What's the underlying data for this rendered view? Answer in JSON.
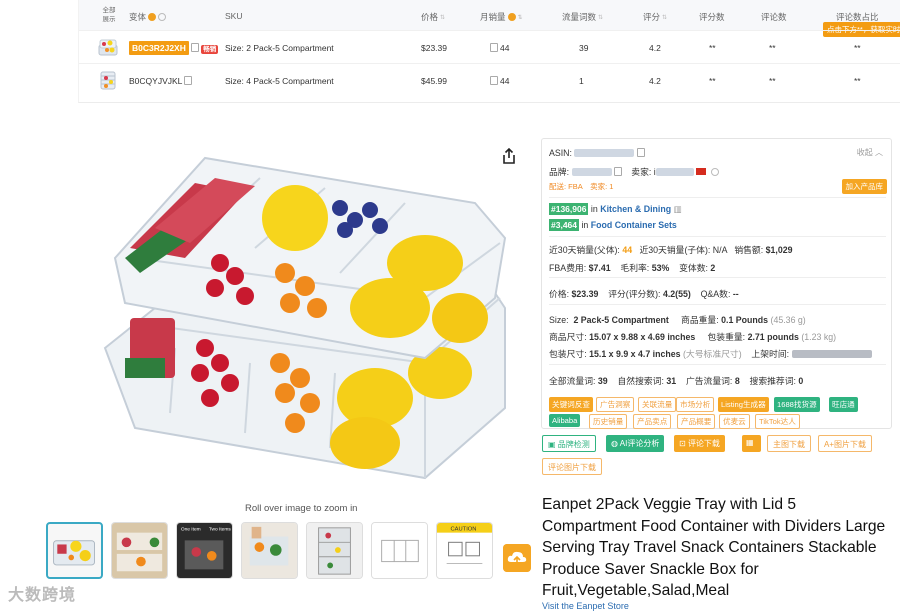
{
  "variant_table": {
    "select_all": "全部展示",
    "columns": {
      "variant": "变体",
      "sku": "SKU",
      "price": "价格",
      "monthly_sales": "月销量",
      "traffic_words": "流量词数",
      "rating": "评分",
      "rating_score": "评分数",
      "review_count": "评论数",
      "review_ratio": "评论数占比"
    },
    "tooltip": "点击下方**，获取实时数据",
    "rows": [
      {
        "asin": "B0C3R2J2XH",
        "tag": "畅销",
        "sku": "Size: 2 Pack-5 Compartment",
        "price": "$23.39",
        "sales": "44",
        "traffic": "39",
        "rating": "4.2",
        "rating_score": "**",
        "reviews": "**",
        "ratio": "**"
      },
      {
        "asin": "B0CQYJVJKL",
        "tag": "",
        "sku": "Size: 4 Pack-5 Compartment",
        "price": "$45.99",
        "sales": "44",
        "traffic": "1",
        "rating": "4.2",
        "rating_score": "**",
        "reviews": "**",
        "ratio": "**"
      }
    ]
  },
  "gallery": {
    "zoom_hint": "Roll over image to zoom in",
    "thumb_caution": "CAUTION",
    "thumb_one": "One Item",
    "thumb_two": "Two Items"
  },
  "watermark": "大数跨境",
  "panel": {
    "asin_label": "ASIN:",
    "collapse": "收起",
    "brand_label": "品牌:",
    "seller_label": "卖家:",
    "seller_prefix": "i",
    "delivery": "配送: FBA",
    "seller_count": "卖家: 1",
    "add_product": "加入产品库",
    "rank1_num": "#136,906",
    "rank1_in": "in",
    "rank1_cat": "Kitchen & Dining",
    "rank2_num": "#3,464",
    "rank2_in": "in",
    "rank2_cat": "Food Container Sets",
    "sales30_parent_label": "近30天销量(父体):",
    "sales30_parent": "44",
    "sales30_child_label": "近30天销量(子体):",
    "sales30_child": "N/A",
    "revenue_label": "销售额:",
    "revenue": "$1,029",
    "fba_label": "FBA费用:",
    "fba": "$7.41",
    "margin_label": "毛利率:",
    "margin": "53%",
    "variants_label": "变体数:",
    "variants": "2",
    "price_label": "价格:",
    "price": "$23.39",
    "rating_label": "评分(评分数):",
    "rating": "4.2(55)",
    "qa_label": "Q&A数:",
    "qa": "--",
    "size_label": "Size:",
    "size": "2 Pack-5 Compartment",
    "item_weight_label": "商品重量:",
    "item_weight": "0.1 Pounds",
    "item_weight_g": "(45.36 g)",
    "item_dim_label": "商品尺寸:",
    "item_dim": "15.07 x 9.88 x 4.69 inches",
    "pkg_weight_label": "包装重量:",
    "pkg_weight": "2.71 pounds",
    "pkg_weight_g": "(1.23 kg)",
    "pkg_dim_label": "包装尺寸:",
    "pkg_dim": "15.1 x 9.9 x 4.7 inches",
    "pkg_std": "(大号标准尺寸)",
    "listed_label": "上架时间:",
    "traffic_all_label": "全部流量词:",
    "traffic_all": "39",
    "traffic_natural_label": "自然搜索词:",
    "traffic_natural": "31",
    "traffic_ad_label": "广告流量词:",
    "traffic_ad": "8",
    "traffic_rec_label": "搜索推荐词:",
    "traffic_rec": "0",
    "chips_row1": [
      "关键词反查",
      "广告洞察",
      "关联流量",
      "市场分析",
      "Listing生成器",
      "1688找货源",
      "旺店通"
    ],
    "chips_row2": [
      "Alibaba",
      "历史销量",
      "产品卖点",
      "产品概要",
      "优麦云",
      "TikTok达人"
    ]
  },
  "buttons": {
    "product_check": "品牌检测",
    "ai_review": "AI评论分析",
    "review_download": "评论下载",
    "main_img_download": "主图下载",
    "aplus_download": "A+图片下载",
    "review_img_download": "评论图片下载"
  },
  "product": {
    "title": "Eanpet 2Pack Veggie Tray with Lid 5 Compartment Food Container with Dividers Large Serving Tray Travel Snack Containers Stackable Produce Saver Snackle Box for Fruit,Vegetable,Salad,Meal",
    "store_link": "Visit the Eanpet Store"
  },
  "colors": {
    "accent_orange": "#f5a623",
    "accent_green": "#2fb380",
    "link_blue": "#2b6cb0"
  }
}
